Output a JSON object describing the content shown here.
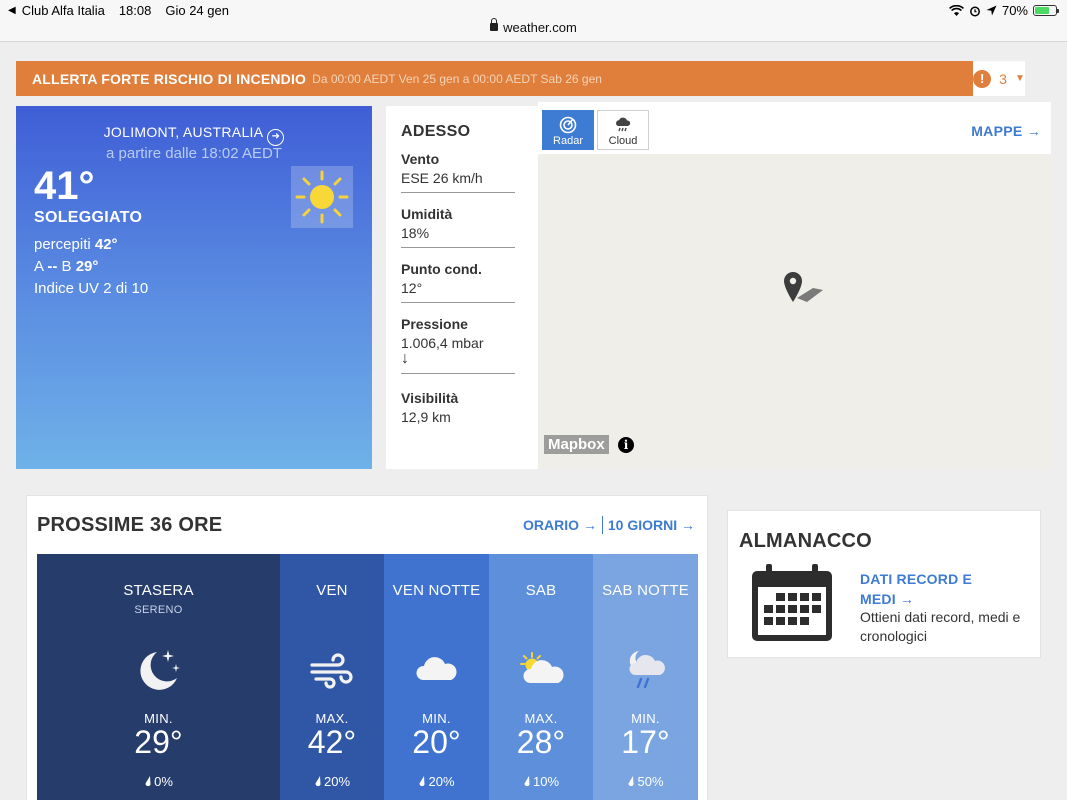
{
  "status_bar": {
    "back_app": "Club Alfa Italia",
    "time": "18:08",
    "date": "Gio 24 gen",
    "battery": "70%",
    "battery_level": 0.7
  },
  "url": "weather.com",
  "alert": {
    "title": "ALLERTA FORTE RISCHIO DI INCENDIO",
    "period": "Da 00:00 AEDT Ven 25 gen a 00:00 AEDT Sab 26 gen",
    "count": "3",
    "color": "#e07f3c"
  },
  "current": {
    "location": "JOLIMONT, AUSTRALIA",
    "as_of": "a partire dalle 18:02 AEDT",
    "temp": "41°",
    "phrase": "SOLEGGIATO",
    "feels_label": "percepiti",
    "feels_value": "42°",
    "hilo_prefix": "A",
    "hilo_high": "--",
    "hilo_mid": "B",
    "hilo_low": "29°",
    "uv": "Indice UV 2 di 10",
    "icon": "sun-icon"
  },
  "now": {
    "title": "ADESSO",
    "items": [
      {
        "label": "Vento",
        "value": "ESE 26 km/h"
      },
      {
        "label": "Umidità",
        "value": "18%"
      },
      {
        "label": "Punto cond.",
        "value": "12°"
      },
      {
        "label": "Pressione",
        "value": "1.006,4 mbar",
        "trend": "↓"
      },
      {
        "label": "Visibilità",
        "value": "12,9 km"
      }
    ]
  },
  "map": {
    "buttons": [
      {
        "label": "Radar",
        "icon": "radar-icon",
        "active": true
      },
      {
        "label": "Cloud",
        "icon": "cloud-rain-icon",
        "active": false
      }
    ],
    "link": "MAPPE →",
    "attribution": "Mapbox",
    "info": "i"
  },
  "forecast": {
    "title": "PROSSIME 36 ORE",
    "link_hourly": "ORARIO →",
    "link_10day": "10 GIORNI →",
    "periods": [
      {
        "name": "STASERA",
        "phrase": "SERENO",
        "icon": "moon-stars-icon",
        "label": "MIN.",
        "temp": "29°",
        "precip": "0%",
        "color": "#263c6b"
      },
      {
        "name": "VEN",
        "phrase": "",
        "icon": "wind-icon",
        "label": "MAX.",
        "temp": "42°",
        "precip": "20%",
        "color": "#2f57a6"
      },
      {
        "name": "VEN NOTTE",
        "phrase": "",
        "icon": "cloud-icon",
        "label": "MIN.",
        "temp": "20°",
        "precip": "20%",
        "color": "#3f73cf"
      },
      {
        "name": "SAB",
        "phrase": "",
        "icon": "partly-cloudy-icon",
        "label": "MAX.",
        "temp": "28°",
        "precip": "10%",
        "color": "#5d8fda"
      },
      {
        "name": "SAB NOTTE",
        "phrase": "",
        "icon": "night-showers-icon",
        "label": "MIN.",
        "temp": "17°",
        "precip": "50%",
        "color": "#7aa5e0"
      }
    ]
  },
  "almanac": {
    "title": "ALMANACCO",
    "link": "DATI RECORD E MEDI →",
    "description": "Ottieni dati record, medi e cronologici",
    "icon": "calendar-icon"
  }
}
